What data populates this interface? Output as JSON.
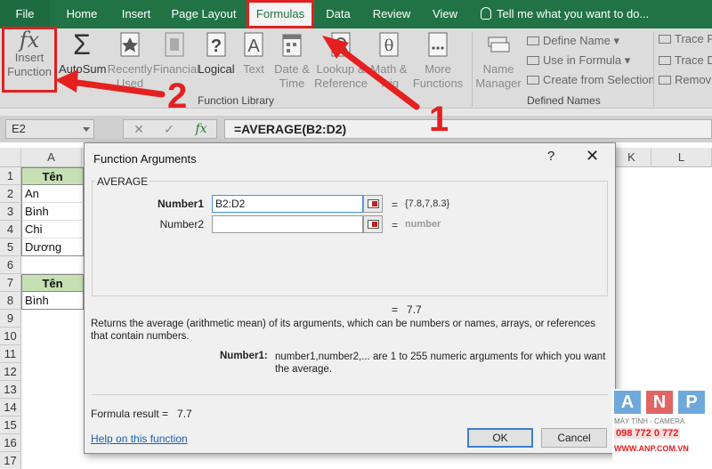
{
  "ribbon_tabs": [
    "File",
    "Home",
    "Insert",
    "Page Layout",
    "Formulas",
    "Data",
    "Review",
    "View"
  ],
  "tell_me": "Tell me what you want to do...",
  "ribbon": {
    "insert_function": "Insert Function",
    "autosum": "AutoSum",
    "recently_used": "Recently Used",
    "financial": "Financial",
    "logical": "Logical",
    "text": "Text",
    "date_time": "Date & Time",
    "lookup": "Lookup & Reference",
    "math": "Math & Trig",
    "more": "More Functions",
    "group_function_library": "Function Library",
    "name_manager": "Name Manager",
    "define_name": "Define Name",
    "use_in_formula": "Use in Formula",
    "create_from_selection": "Create from Selection",
    "group_defined_names": "Defined Names",
    "trace_precedents": "Trace P",
    "trace_dependents": "Trace D",
    "remove_arrows": "Remov"
  },
  "formula_bar": {
    "name_box": "E2",
    "formula": "=AVERAGE(B2:D2)",
    "fx": "fx"
  },
  "grid": {
    "columns": [
      "A",
      "K",
      "L"
    ],
    "rows": [
      "1",
      "2",
      "3",
      "4",
      "5",
      "6",
      "7",
      "8",
      "9",
      "10",
      "11",
      "12",
      "13",
      "14",
      "15",
      "16",
      "17"
    ],
    "cells": {
      "a1": "Tên",
      "a2": "An",
      "a3": "Bình",
      "a4": "Chi",
      "a5": "Dương",
      "a7": "Tên",
      "a8": "Bình"
    }
  },
  "dialog": {
    "title": "Function Arguments",
    "help": "?",
    "close": "✕",
    "function_name": "AVERAGE",
    "arg1_label": "Number1",
    "arg1_value": "B2:D2",
    "arg1_result": "{7.8,7,8.3}",
    "arg2_label": "Number2",
    "arg2_value": "",
    "arg2_result": "number",
    "equals": "=",
    "result_value": "7.7",
    "description": "Returns the average (arithmetic mean) of its arguments, which can be numbers or names, arrays, or references that contain numbers.",
    "arg_desc_name": "Number1:",
    "arg_desc_text": "number1,number2,... are 1 to 255 numeric arguments for which you want the average.",
    "formula_result_label": "Formula result =",
    "formula_result_value": "7.7",
    "help_link": "Help on this function",
    "ok": "OK",
    "cancel": "Cancel"
  },
  "annotations": {
    "step1": "1",
    "step2": "2",
    "color": "#e52020"
  },
  "watermark": {
    "letters": [
      "A",
      "N",
      "P"
    ],
    "tagline": "MÁY TÍNH - CAMERA",
    "phone": "098 772 0 772",
    "site": "WWW.ANP.COM.VN"
  },
  "colors": {
    "excel_green": "#217346",
    "header_fill": "#c6e0b4",
    "red": "#e02020"
  }
}
